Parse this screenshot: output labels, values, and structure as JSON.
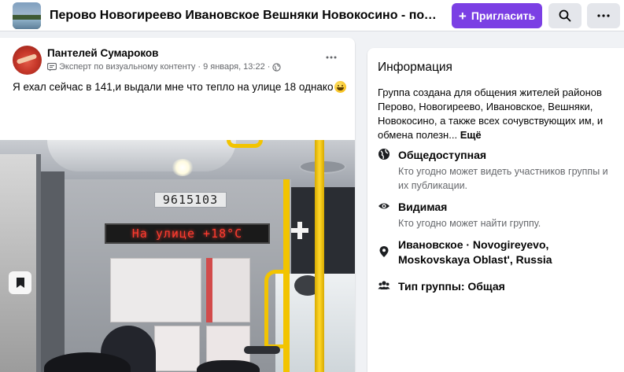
{
  "header": {
    "group_title": "Перово Новогиреево Ивановское Вешняки Новокосино - полезн...",
    "invite_label": "Пригласить",
    "icons": {
      "search": "search-icon",
      "more": "more-horizontal-icon"
    }
  },
  "post": {
    "author": "Пантелей Сумароков",
    "badge": "Эксперт по визуальному контенту",
    "separator": "·",
    "date": "9 января, 13:22",
    "text": "Я ехал сейчас в 141,и выдали мне что тепло на улице 18 однако",
    "photo": {
      "bus_number": "9615103",
      "led_sign": "На улице +18°C"
    }
  },
  "info": {
    "title": "Информация",
    "description": "Группа создана для общения жителей районов Перово, Новогиреево, Ивановское, Вешняки, Новокосино, а также всех сочувствующих им, и обмена полезн...",
    "more": "Ещё",
    "privacy": {
      "title": "Общедоступная",
      "subtitle": "Кто угодно может видеть участников группы и их публикации."
    },
    "visibility": {
      "title": "Видимая",
      "subtitle": "Кто угодно может найти группу."
    },
    "location": {
      "title": "Ивановское · Novogireyevo, Moskovskaya Oblast', Russia"
    },
    "group_type": {
      "title": "Тип группы: Общая"
    }
  },
  "colors": {
    "accent": "#7b3fe4",
    "led": "#ff3b2f",
    "pole": "#f2c400"
  }
}
